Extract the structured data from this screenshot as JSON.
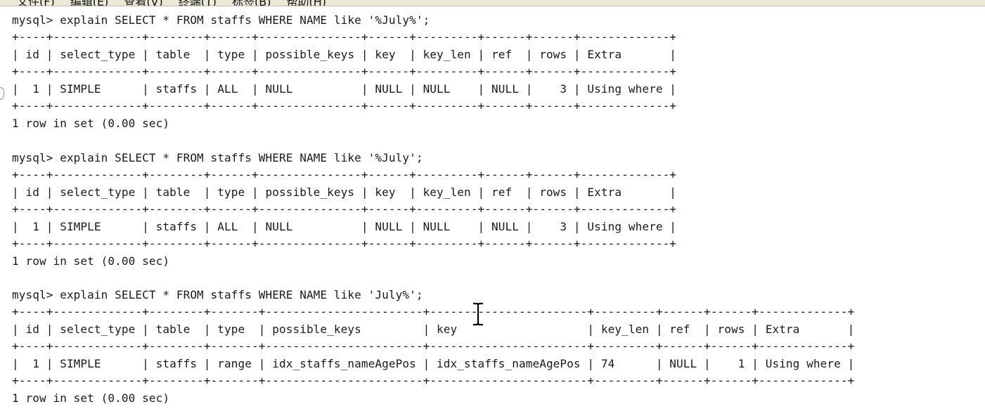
{
  "menubar": {
    "items": [
      "文件(F)",
      "编辑(E)",
      "查看(V)",
      "终端(T)",
      "标签(B)",
      "帮助(H)"
    ]
  },
  "terminal": {
    "lines": [
      "mysql> explain SELECT * FROM staffs WHERE NAME like '%July%';",
      "+----+-------------+--------+------+---------------+------+---------+------+------+-------------+",
      "| id | select_type | table  | type | possible_keys | key  | key_len | ref  | rows | Extra       |",
      "+----+-------------+--------+------+---------------+------+---------+------+------+-------------+",
      "|  1 | SIMPLE      | staffs | ALL  | NULL          | NULL | NULL    | NULL |    3 | Using where |",
      "+----+-------------+--------+------+---------------+------+---------+------+------+-------------+",
      "1 row in set (0.00 sec)",
      "",
      "mysql> explain SELECT * FROM staffs WHERE NAME like '%July';",
      "+----+-------------+--------+------+---------------+------+---------+------+------+-------------+",
      "| id | select_type | table  | type | possible_keys | key  | key_len | ref  | rows | Extra       |",
      "+----+-------------+--------+------+---------------+------+---------+------+------+-------------+",
      "|  1 | SIMPLE      | staffs | ALL  | NULL          | NULL | NULL    | NULL |    3 | Using where |",
      "+----+-------------+--------+------+---------------+------+---------+------+------+-------------+",
      "1 row in set (0.00 sec)",
      "",
      "mysql> explain SELECT * FROM staffs WHERE NAME like 'July%';",
      "+----+-------------+--------+-------+-----------------------+-----------------------+---------+------+------+-------------+",
      "| id | select_type | table  | type  | possible_keys         | key                   | key_len | ref  | rows | Extra       |",
      "+----+-------------+--------+-------+-----------------------+-----------------------+---------+------+------+-------------+",
      "|  1 | SIMPLE      | staffs | range | idx_staffs_nameAgePos | idx_staffs_nameAgePos | 74      | NULL |    1 | Using where |",
      "+----+-------------+--------+-------+-----------------------+-----------------------+---------+------+------+-------------+",
      "1 row in set (0.00 sec)"
    ]
  },
  "cursor": {
    "icon": "i-beam-cursor-icon"
  }
}
